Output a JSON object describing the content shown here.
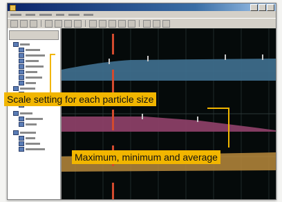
{
  "annotations": {
    "scale_callout": "Scale setting for each particle size",
    "stats_callout": "Maximum, minimum and average"
  },
  "colors": {
    "callout_bg": "#f2b600",
    "plot_background": "#050a0a",
    "series_blue": "#3d6b8a",
    "series_pink": "#8a3f66",
    "series_orange": "#b9893c",
    "marker_red": "#d34a2e",
    "grid": "#1f2a2a"
  },
  "window": {
    "title_bar": "blurred",
    "win_buttons": [
      "minimize-icon",
      "maximize-icon",
      "close-icon"
    ]
  },
  "icons": {
    "app": "app-icon",
    "tree": "folder-icon"
  }
}
